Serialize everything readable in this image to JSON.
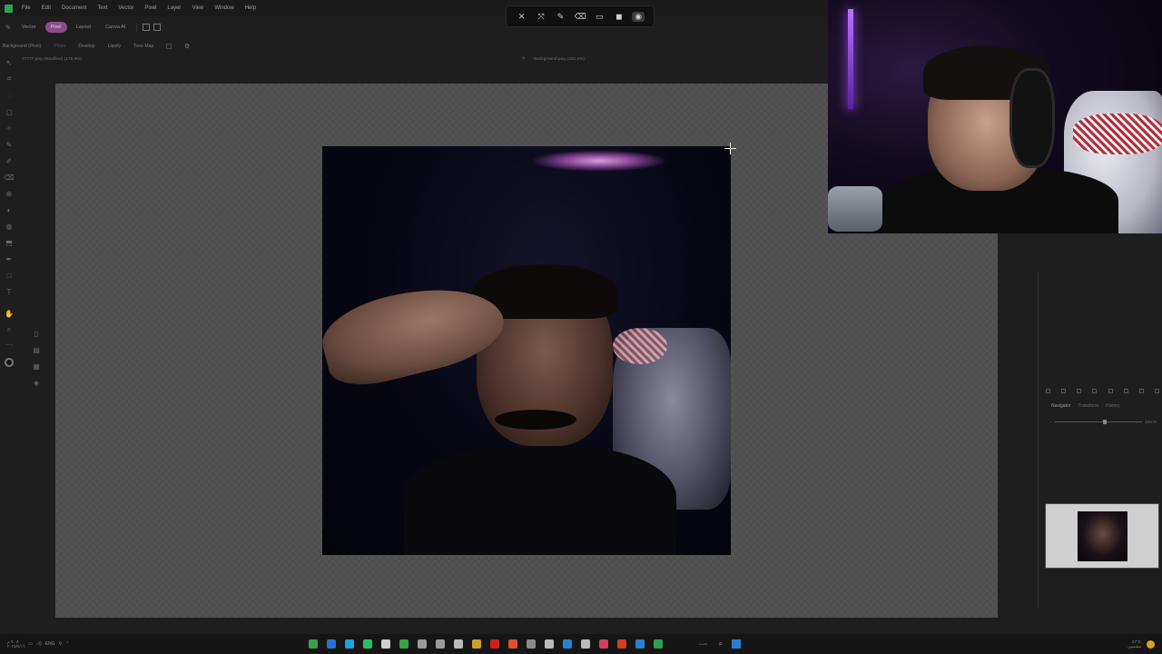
{
  "menubar": {
    "items": [
      "File",
      "Edit",
      "Document",
      "Text",
      "Vector",
      "Pixel",
      "Layer",
      "View",
      "Window",
      "Help"
    ]
  },
  "toolbar": {
    "vector": "Vector",
    "pixel": "Pixel",
    "layout": "Layout",
    "canva_ai": "Canva AI"
  },
  "studio": {
    "layer_name": "Background (Pixel)",
    "tabs": [
      "Photo",
      "Develop",
      "Liquify",
      "Tone Map"
    ]
  },
  "documents": {
    "tab1": "77777.png (Modified) (179.8%)",
    "tab2": "Background.png (100.2%)"
  },
  "panel": {
    "tabs": [
      "Navigator",
      "Transform",
      "History"
    ],
    "zoom": "100 %"
  },
  "taskbar": {
    "clock_time": "٩:٠٨ م",
    "clock_date": "٢٠٢٥/٧/١٦",
    "lang": "ENG",
    "search_placeholder": "بحث",
    "weather_temp": "27°C",
    "weather_desc": "مشمس",
    "icon_colors": [
      "#3aa04a",
      "#2a6fd0",
      "#1fa0e0",
      "#25c060",
      "#d0d0d0",
      "#3aa04a",
      "#9a9a9a",
      "#9a9a9a",
      "#bbbbbb",
      "#c8a030",
      "#d02020",
      "#e05030",
      "#8a8a8a",
      "#bbbbbb",
      "#2a80d0",
      "#bbbbbb",
      "#d04060",
      "#d04020",
      "#2a80d0",
      "#30a050"
    ]
  },
  "accent": {
    "pixel_persona": "#8a4d8c",
    "app_logo": "#2aa34a"
  }
}
